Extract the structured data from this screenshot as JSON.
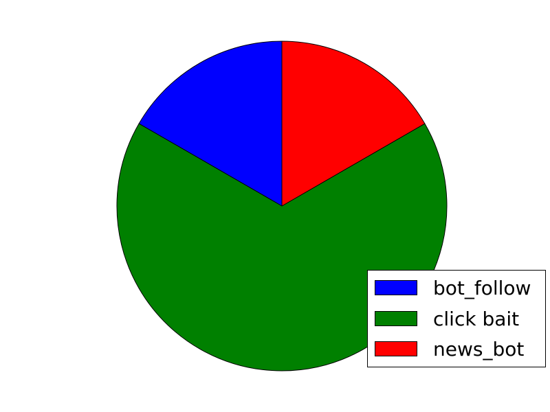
{
  "chart_data": {
    "type": "pie",
    "title": "",
    "slices": [
      {
        "label": "bot_follow",
        "value": 16.67,
        "color": "#0000ff"
      },
      {
        "label": "click bait",
        "value": 66.67,
        "color": "#008000"
      },
      {
        "label": "news_bot",
        "value": 16.67,
        "color": "#ff0000"
      }
    ],
    "start_angle_deg": 90,
    "direction": "counterclockwise",
    "legend_position": "lower-right"
  },
  "legend": {
    "items": [
      {
        "label": "bot_follow",
        "color": "#0000ff"
      },
      {
        "label": "click bait",
        "color": "#008000"
      },
      {
        "label": "news_bot",
        "color": "#ff0000"
      }
    ]
  }
}
